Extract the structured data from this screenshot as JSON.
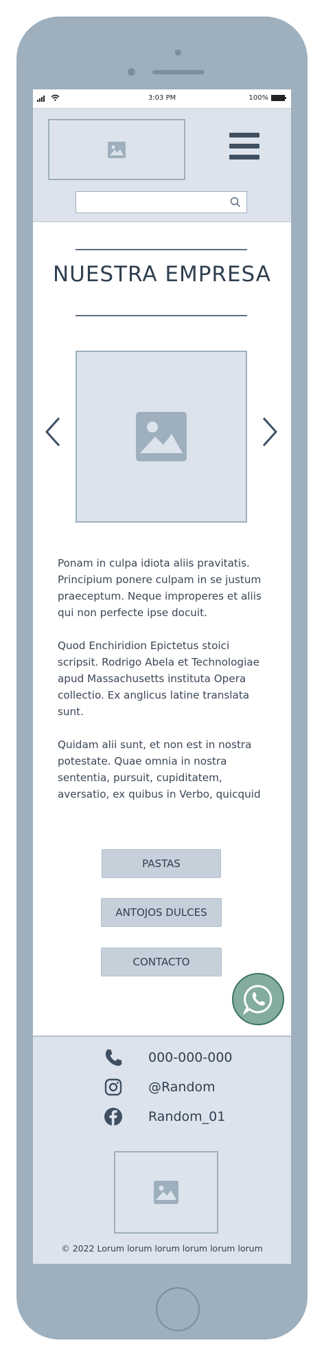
{
  "status_bar": {
    "time": "3:03 PM",
    "battery": "100%"
  },
  "header": {
    "search": {
      "placeholder": "",
      "value": ""
    }
  },
  "main": {
    "title": "NUESTRA EMPRESA",
    "paragraphs": [
      "Ponam in culpa idiota aliis pravitatis. Principium ponere culpam in se justum praeceptum. Neque improperes et aliis qui non perfecte ipse docuit.",
      "Quod Enchiridion Epictetus stoici scripsit. Rodrigo Abela et Technologiae apud Massachusetts instituta Opera collectio. Ex anglicus latine translata sunt.",
      "Quidam alii sunt, et non est in nostra potestate. Quae omnia in nostra sententia, pursuit, cupiditatem, aversatio, ex quibus in Verbo, quicquid"
    ],
    "buttons": [
      "PASTAS",
      "ANTOJOS DULCES",
      "CONTACTO"
    ]
  },
  "footer": {
    "phone": "000-000-000",
    "instagram": "@Random",
    "facebook": "Random_01",
    "copyright": "© 2022  Lorum lorum lorum lorum lorum lorum"
  },
  "colors": {
    "device": "#9eafbd",
    "panel": "#dde3ec",
    "button": "#c5d0da",
    "text": "#3a4655",
    "whatsapp": "#84ad9e"
  },
  "icons": [
    "image-placeholder-icon",
    "hamburger-icon",
    "search-icon",
    "chevron-left-icon",
    "chevron-right-icon",
    "whatsapp-icon",
    "phone-icon",
    "instagram-icon",
    "facebook-icon"
  ]
}
